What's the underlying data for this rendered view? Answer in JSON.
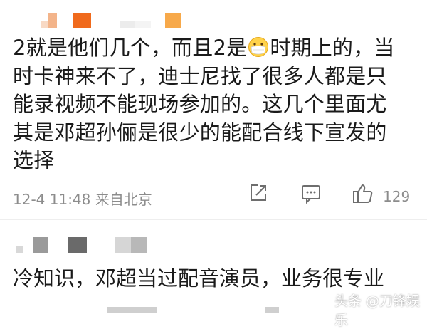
{
  "comment": {
    "line1_part1": "2就是他们几个，而且2是",
    "emoji": "mask-face-emoji",
    "line1_part2": "时期上的，当",
    "lines": [
      "时卡神来不了，迪士尼找了很多人都是只",
      "能录视频不能现场参加的。这几个里面尤",
      "其是邓超孙俪是很少的能配合线下宣发的",
      "选择"
    ],
    "meta": "12-4 11:48 来自北京",
    "like_count": "129",
    "icons": [
      "share-icon",
      "comment-icon",
      "like-icon"
    ]
  },
  "reply": {
    "text": "冷知识，邓超当过配音演员，业务很专业"
  },
  "watermark": "头条 @刀锋娱乐",
  "colors": {
    "text": "#1a1a1a",
    "meta": "#8c8c8c",
    "mosaic_orange": "#f07a2a",
    "mosaic_gray": "#9a9a9a"
  }
}
